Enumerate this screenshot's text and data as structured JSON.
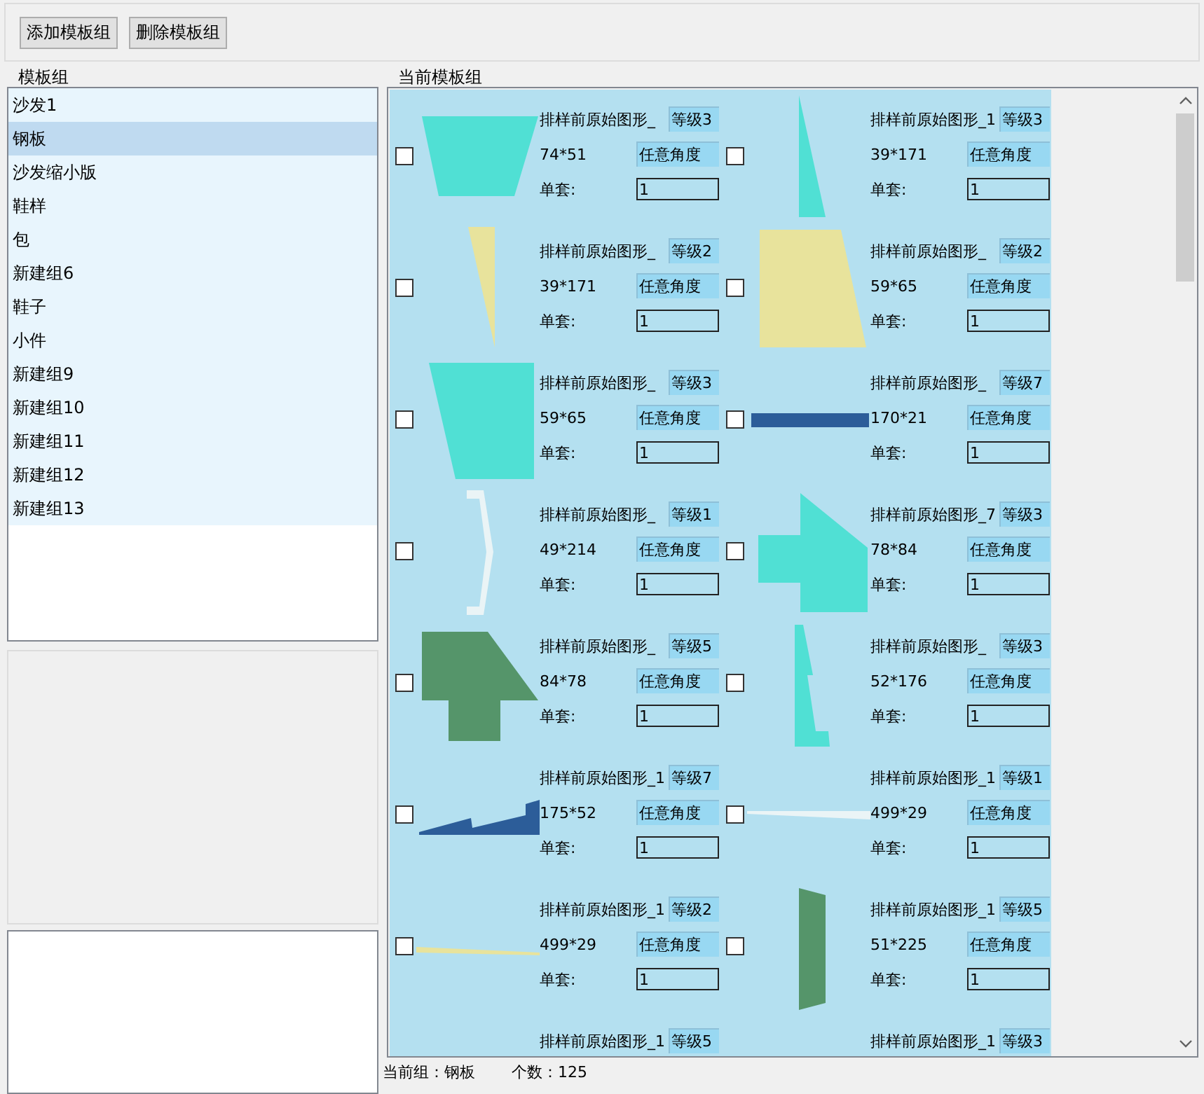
{
  "toolbar": {
    "buttons": [
      "添加模板组",
      "删除模板组"
    ]
  },
  "template_groups": {
    "title": "模板组",
    "items": [
      {
        "label": "沙发1",
        "selected": false
      },
      {
        "label": "钢板",
        "selected": true
      },
      {
        "label": "沙发缩小版",
        "selected": false
      },
      {
        "label": "鞋样",
        "selected": false
      },
      {
        "label": "包",
        "selected": false
      },
      {
        "label": "新建组6",
        "selected": false
      },
      {
        "label": "鞋子",
        "selected": false
      },
      {
        "label": "小件",
        "selected": false
      },
      {
        "label": "新建组9",
        "selected": false
      },
      {
        "label": "新建组10",
        "selected": false
      },
      {
        "label": "新建组11",
        "selected": false
      },
      {
        "label": "新建组12",
        "selected": false
      },
      {
        "label": "新建组13",
        "selected": false
      }
    ]
  },
  "current_group": {
    "title": "当前模板组",
    "shapes": [
      {
        "name": "排样前原始图形_",
        "grade": "等级3",
        "size": "74*51",
        "rotation": "任意角度",
        "count_label": "单套:",
        "count": "1",
        "checked": false
      },
      {
        "name": "排样前原始图形_1",
        "grade": "等级3",
        "size": "39*171",
        "rotation": "任意角度",
        "count_label": "单套:",
        "count": "1",
        "checked": false
      },
      {
        "name": "排样前原始图形_",
        "grade": "等级2",
        "size": "39*171",
        "rotation": "任意角度",
        "count_label": "单套:",
        "count": "1",
        "checked": false
      },
      {
        "name": "排样前原始图形_",
        "grade": "等级2",
        "size": "59*65",
        "rotation": "任意角度",
        "count_label": "单套:",
        "count": "1",
        "checked": false
      },
      {
        "name": "排样前原始图形_",
        "grade": "等级3",
        "size": "59*65",
        "rotation": "任意角度",
        "count_label": "单套:",
        "count": "1",
        "checked": false
      },
      {
        "name": "排样前原始图形_",
        "grade": "等级7",
        "size": "170*21",
        "rotation": "任意角度",
        "count_label": "单套:",
        "count": "1",
        "checked": false
      },
      {
        "name": "排样前原始图形_",
        "grade": "等级1",
        "size": "49*214",
        "rotation": "任意角度",
        "count_label": "单套:",
        "count": "1",
        "checked": false
      },
      {
        "name": "排样前原始图形_7",
        "grade": "等级3",
        "size": "78*84",
        "rotation": "任意角度",
        "count_label": "单套:",
        "count": "1",
        "checked": false
      },
      {
        "name": "排样前原始图形_",
        "grade": "等级5",
        "size": "84*78",
        "rotation": "任意角度",
        "count_label": "单套:",
        "count": "1",
        "checked": false
      },
      {
        "name": "排样前原始图形_",
        "grade": "等级3",
        "size": "52*176",
        "rotation": "任意角度",
        "count_label": "单套:",
        "count": "1",
        "checked": false
      },
      {
        "name": "排样前原始图形_1",
        "grade": "等级7",
        "size": "175*52",
        "rotation": "任意角度",
        "count_label": "单套:",
        "count": "1",
        "checked": false
      },
      {
        "name": "排样前原始图形_1",
        "grade": "等级1",
        "size": "499*29",
        "rotation": "任意角度",
        "count_label": "单套:",
        "count": "1",
        "checked": false
      },
      {
        "name": "排样前原始图形_1",
        "grade": "等级2",
        "size": "499*29",
        "rotation": "任意角度",
        "count_label": "单套:",
        "count": "1",
        "checked": false
      },
      {
        "name": "排样前原始图形_1",
        "grade": "等级5",
        "size": "51*225",
        "rotation": "任意角度",
        "count_label": "单套:",
        "count": "1",
        "checked": false
      },
      {
        "name": "排样前原始图形_1",
        "grade": "等级5"
      },
      {
        "name": "排样前原始图形_1",
        "grade": "等级3"
      }
    ]
  },
  "status_bar": {
    "current_group": "当前组：钢板",
    "count": "个数：125"
  }
}
